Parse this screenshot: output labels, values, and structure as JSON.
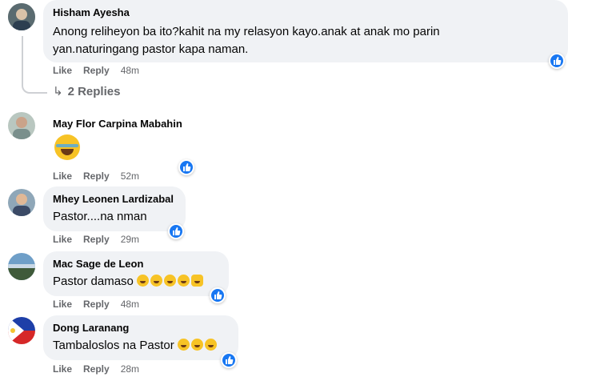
{
  "comments": [
    {
      "name": "Hisham Ayesha",
      "text_line1": "Anong reliheyon ba ito?kahit na my relasyon kayo.anak at anak mo parin",
      "text_line2": "yan.naturingang pastor kapa naman.",
      "like": "Like",
      "reply": "Reply",
      "time": "48m"
    },
    {
      "name": "May Flor Carpina Mabahin",
      "text": "",
      "like": "Like",
      "reply": "Reply",
      "time": "52m"
    },
    {
      "name": "Mhey Leonen Lardizabal",
      "text": "Pastor....na nman",
      "like": "Like",
      "reply": "Reply",
      "time": "29m"
    },
    {
      "name": "Mac Sage de Leon",
      "text": "Pastor damaso",
      "like": "Like",
      "reply": "Reply",
      "time": "48m"
    },
    {
      "name": "Dong Laranang",
      "text": "Tambaloslos na Pastor",
      "like": "Like",
      "reply": "Reply",
      "time": "28m"
    }
  ],
  "replies_label": "2 Replies",
  "reaction_icon": "thumbs-up-icon",
  "accent": "#1877f2"
}
